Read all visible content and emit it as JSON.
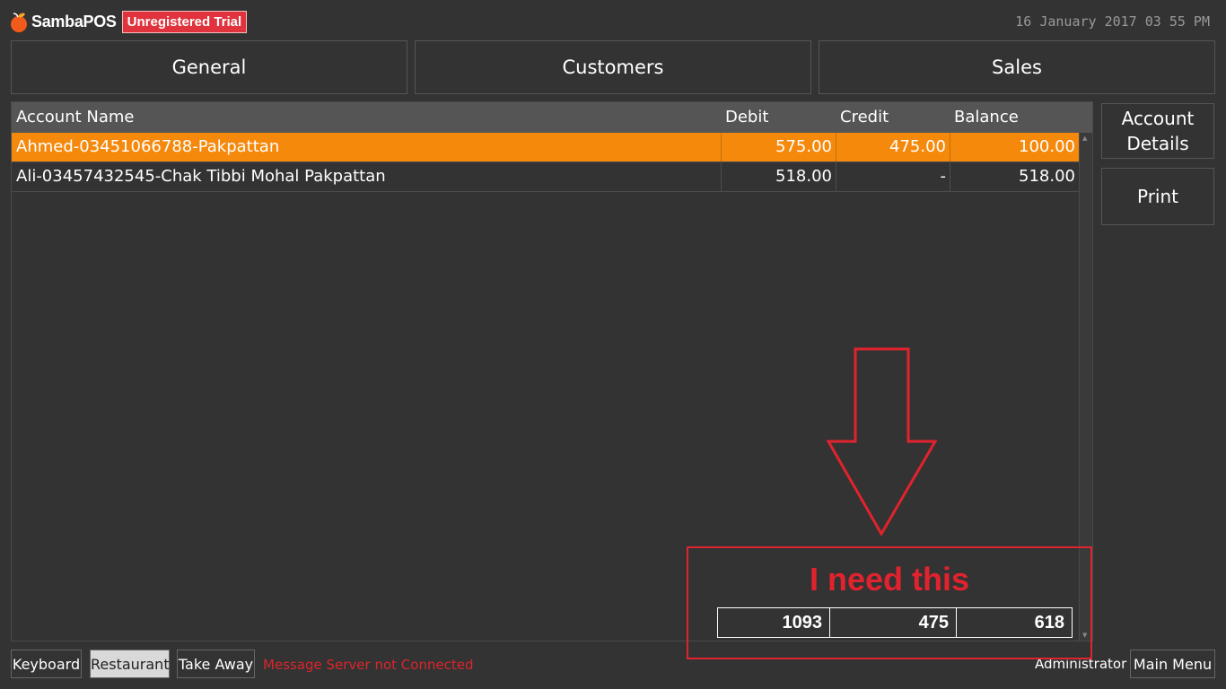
{
  "app": {
    "logo_text": "SambaPOS",
    "trial_badge": "Unregistered Trial",
    "datetime": "16 January 2017 03 55 PM"
  },
  "tabs": [
    {
      "label": "General"
    },
    {
      "label": "Customers"
    },
    {
      "label": "Sales"
    }
  ],
  "grid": {
    "headers": {
      "name": "Account Name",
      "debit": "Debit",
      "credit": "Credit",
      "balance": "Balance"
    },
    "rows": [
      {
        "name": "Ahmed-03451066788-Pakpattan",
        "debit": "575.00",
        "credit": "475.00",
        "balance": "100.00",
        "selected": true
      },
      {
        "name": "Ali-03457432545-Chak Tibbi Mohal Pakpattan",
        "debit": "518.00",
        "credit": "-",
        "balance": "518.00",
        "selected": false
      }
    ]
  },
  "side_buttons": {
    "account_details_line1": "Account",
    "account_details_line2": "Details",
    "print": "Print"
  },
  "bottom": {
    "keyboard": "Keyboard",
    "restaurant": "Restaurant",
    "take_away": "Take Away",
    "message": "Message Server not Connected",
    "user": "Administrator",
    "main_menu": "Main Menu"
  },
  "annotation": {
    "text": "I need this",
    "totals": {
      "debit": "1093",
      "credit": "475",
      "balance": "618"
    },
    "color": "#e0232e"
  },
  "colors": {
    "background": "#333333",
    "selected_row": "#f5890c",
    "header": "#555555",
    "trial_badge": "#e0333d",
    "error_text": "#d9262c"
  }
}
